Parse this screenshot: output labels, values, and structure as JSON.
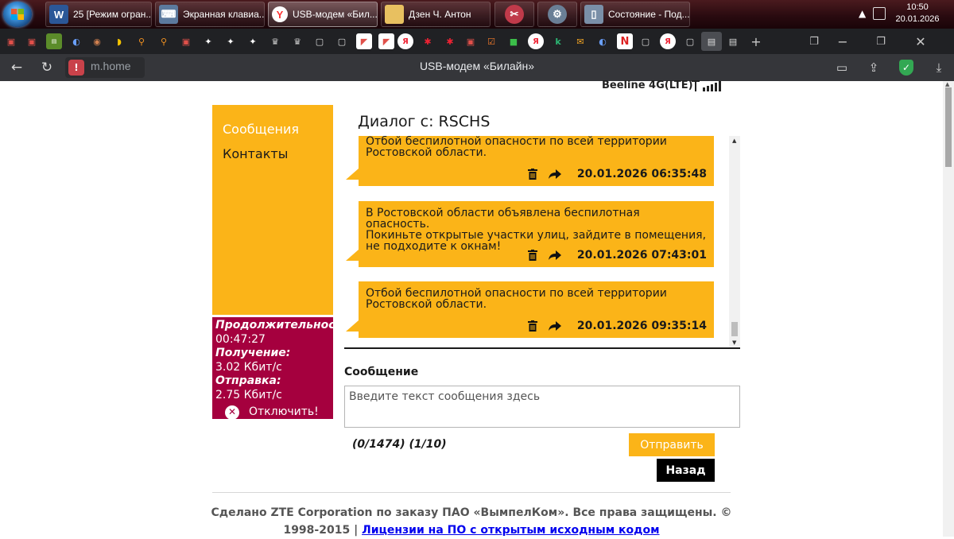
{
  "taskbar": {
    "buttons": [
      {
        "label": "25 [Режим огран...",
        "icon": "word-icon"
      },
      {
        "label": "Экранная клавиа...",
        "icon": "keyboard-icon"
      },
      {
        "label": "USB-модем «Бил...",
        "icon": "yandex-browser-icon"
      },
      {
        "label": "Дзен Ч. Антон",
        "icon": "folder-icon"
      },
      {
        "label": "",
        "icon": "snipping-icon"
      },
      {
        "label": "",
        "icon": "gear-icon"
      },
      {
        "label": "Состояние - Под...",
        "icon": "network-adapter-icon"
      }
    ],
    "clock_time": "10:50",
    "clock_date": "20.01.2026"
  },
  "browser": {
    "url": "m.home",
    "title": "USB-модем «Билайн»"
  },
  "status": {
    "network": "Beeline 4G(LTE)"
  },
  "sidebar": {
    "items": [
      {
        "label": "Сообщения"
      },
      {
        "label": "Контакты"
      }
    ]
  },
  "stats": {
    "duration_label": "Продолжительност",
    "duration_value": "00:47:27",
    "receive_label": "Получение:",
    "receive_value": "3.02 Кбит/с",
    "send_label": "Отправка:",
    "send_value": "2.75 Кбит/с",
    "disconnect_label": "Отключить!"
  },
  "dialog": {
    "title": "Диалог с: RSCHS",
    "messages": [
      {
        "text": "Отбой  беспилотной опасности по всей территории\nРостовской области.",
        "date": "20.01.2026 06:35:48"
      },
      {
        "text": "В Ростовской области объявлена беспилотная опасность.\nПокиньте открытые участки улиц, зайдите в помещения,\nне подходите к окнам!",
        "date": "20.01.2026 07:43:01"
      },
      {
        "text": "Отбой  беспилотной опасности по всей территории\nРостовской области.",
        "date": "20.01.2026 09:35:14"
      }
    ]
  },
  "compose": {
    "label": "Сообщение",
    "placeholder": "Введите текст сообщения здесь",
    "counter": "(0/1474) (1/10)",
    "send_label": "Отправить",
    "back_label": "Назад"
  },
  "footer": {
    "text": "Сделано ZTE Corporation по заказу ПАО «ВымпелКом». Все права защищены. © 1998-2015 | ",
    "link": "Лицензии на ПО с открытым исходным кодом"
  },
  "colors": {
    "accent": "#fbb418",
    "stats_bg": "#a5003e",
    "browser_chrome": "#202124"
  }
}
